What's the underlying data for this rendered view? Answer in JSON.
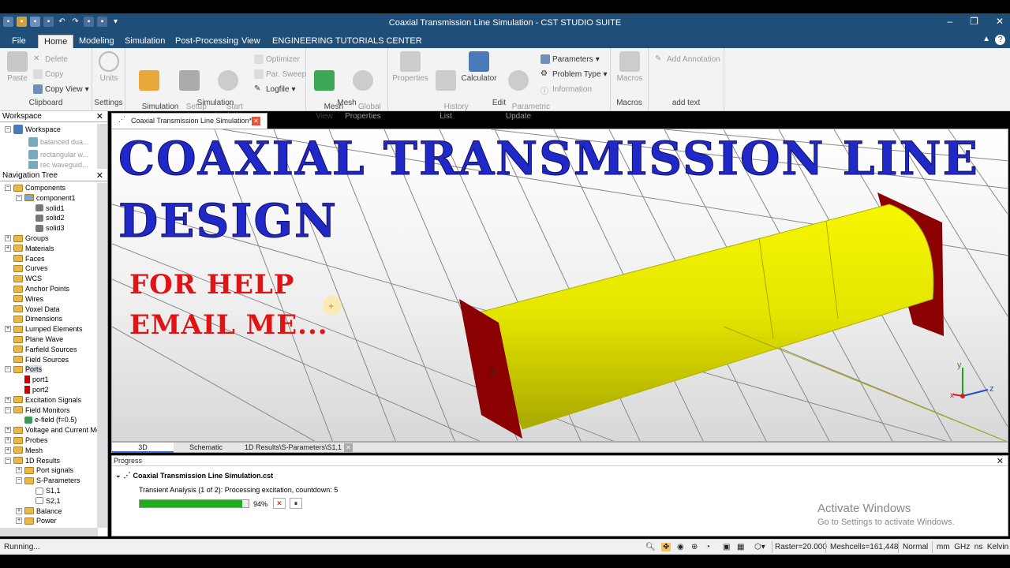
{
  "window": {
    "title": "Coaxial Transmission Line Simulation - CST STUDIO SUITE",
    "controls": [
      "‒",
      "❐",
      "✕"
    ]
  },
  "menu": {
    "tabs": [
      "File",
      "Home",
      "Modeling",
      "Simulation",
      "Post-Processing",
      "View",
      "ENGINEERING TUTORIALS CENTER"
    ],
    "active": "Home",
    "right": [
      "▲",
      "?"
    ]
  },
  "ribbon": {
    "clipboard": {
      "label": "Clipboard",
      "paste": "Paste",
      "delete": "Delete",
      "copy": "Copy",
      "copy_view": "Copy View"
    },
    "settings": {
      "label": "Settings",
      "units": "Units"
    },
    "simulation": {
      "label": "Simulation",
      "sim_project": "Simulation\nProject",
      "setup_solver": "Setup\nSolver",
      "start_simulation": "Start\nSimulation",
      "optimizer": "Optimizer",
      "par_sweep": "Par. Sweep",
      "logfile": "Logfile"
    },
    "mesh": {
      "label": "Mesh",
      "mesh_view": "Mesh\nView",
      "global_properties": "Global\nProperties"
    },
    "edit": {
      "label": "Edit",
      "properties": "Properties",
      "history_list": "History\nList",
      "calculator": "Calculator",
      "parametric_update": "Parametric\nUpdate",
      "parameters": "Parameters",
      "problem_type": "Problem Type",
      "information": "Information"
    },
    "macros": {
      "label": "Macros",
      "macros": "Macros"
    },
    "addtext": {
      "label": "add text",
      "add_annotation": "Add Annotation"
    }
  },
  "workspace": {
    "header": "Workspace",
    "items": [
      "Workspace",
      "balanced dua...",
      "rectangular w...",
      "rec waveguid..."
    ]
  },
  "navtree": {
    "header": "Navigation Tree",
    "items": [
      "Components",
      "component1",
      "solid1",
      "solid2",
      "solid3",
      "Groups",
      "Materials",
      "Faces",
      "Curves",
      "WCS",
      "Anchor Points",
      "Wires",
      "Voxel Data",
      "Dimensions",
      "Lumped Elements",
      "Plane Wave",
      "Farfield Sources",
      "Field Sources",
      "Ports",
      "port1",
      "port2",
      "Excitation Signals",
      "Field Monitors",
      "e-field (f=0.5)",
      "Voltage and Current Mo",
      "Probes",
      "Mesh",
      "1D Results",
      "Port signals",
      "S-Parameters",
      "S1,1",
      "S2,1",
      "Balance",
      "Power"
    ]
  },
  "document": {
    "tab": "Coaxial Transmission Line Simulation*"
  },
  "overlay": {
    "line1": "COAXIAL TRANSMISSION LINE",
    "line2": "DESIGN",
    "help1": "FOR HELP",
    "help2": "EMAIL ME..."
  },
  "viewport": {
    "port_label": "1",
    "axes": {
      "x": "x",
      "y": "y",
      "z": "z"
    }
  },
  "view_tabs": [
    "3D",
    "Schematic",
    "1D Results\\S-Parameters\\S1,1"
  ],
  "progress": {
    "header": "Progress",
    "file": "Coaxial Transmission Line Simulation.cst",
    "task": "Transient Analysis (1 of 2): Processing excitation, countdown: 5",
    "percent": 0.94,
    "percent_text": "94%",
    "cancel": "✕",
    "pause": "⏸"
  },
  "watermark": {
    "line1": "Activate Windows",
    "line2": "Go to Settings to activate Windows."
  },
  "status": {
    "left": "Running...",
    "raster": "Raster=20.000",
    "meshcells": "Meshcells=161,448",
    "normal": "Normal",
    "units": "mm  GHz  ns  Kelvin"
  },
  "colors": {
    "title_blue": "#1f4e79",
    "overlay_blue": "#2028c8",
    "overlay_red": "#e01414",
    "cylinder": "#e2e200",
    "port": "#8b0000",
    "progress": "#22aa22"
  }
}
